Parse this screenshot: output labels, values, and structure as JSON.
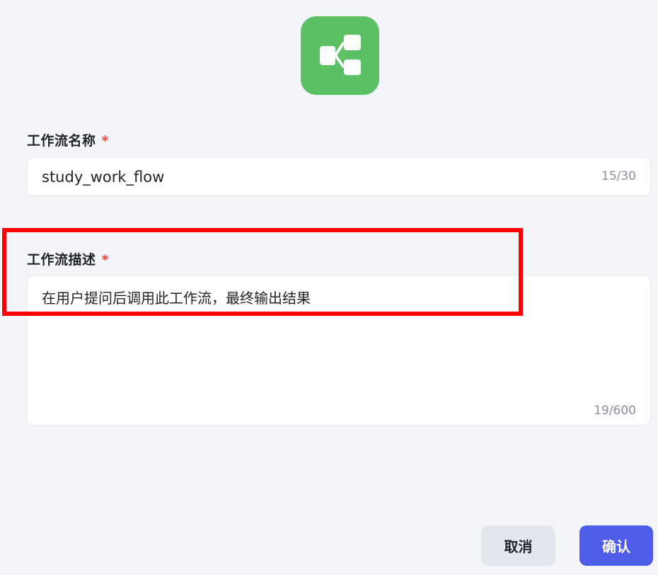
{
  "icon": {
    "name": "workflow-icon",
    "background_color": "#5cc164"
  },
  "form": {
    "name_field": {
      "label": "工作流名称",
      "required_mark": "*",
      "value": "study_work_flow",
      "count": "15/30"
    },
    "desc_field": {
      "label": "工作流描述",
      "required_mark": "*",
      "value": "在用户提问后调用此工作流，最终输出结果",
      "count": "19/600"
    }
  },
  "actions": {
    "cancel_label": "取消",
    "confirm_label": "确认"
  },
  "colors": {
    "accent": "#4e5de8",
    "required": "#f0443b",
    "highlight": "#ff0000"
  }
}
